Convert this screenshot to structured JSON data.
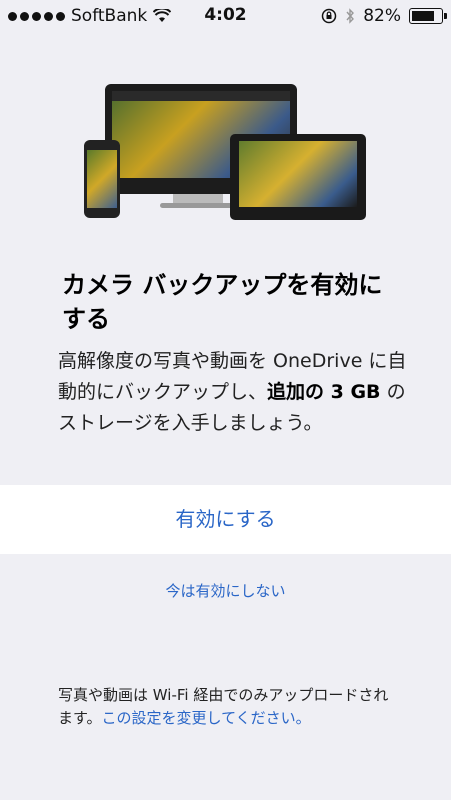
{
  "status_bar": {
    "carrier": "SoftBank",
    "time": "4:02",
    "battery": "82%",
    "battery_level": 0.82,
    "icons": [
      "signal-dots-icon",
      "wifi-icon",
      "rotation-lock-icon",
      "bluetooth-icon",
      "battery-icon"
    ]
  },
  "illustration": {
    "icons": [
      "monitor-icon",
      "phone-icon",
      "tablet-icon"
    ]
  },
  "content": {
    "title": "カメラ バックアップを有効にする",
    "desc_part1": "高解像度の写真や動画を OneDrive に自動的にバックアップし、",
    "desc_bold": "追加の 3 GB",
    "desc_part2": " のストレージを入手しましょう。"
  },
  "actions": {
    "primary_label": "有効にする",
    "secondary_label": "今は有効にしない"
  },
  "footer": {
    "text": "写真や動画は Wi-Fi 経由でのみアップロードされます。",
    "link": "この設定を変更してください。"
  },
  "colors": {
    "accent": "#2a66c7",
    "background": "#efeff4"
  }
}
